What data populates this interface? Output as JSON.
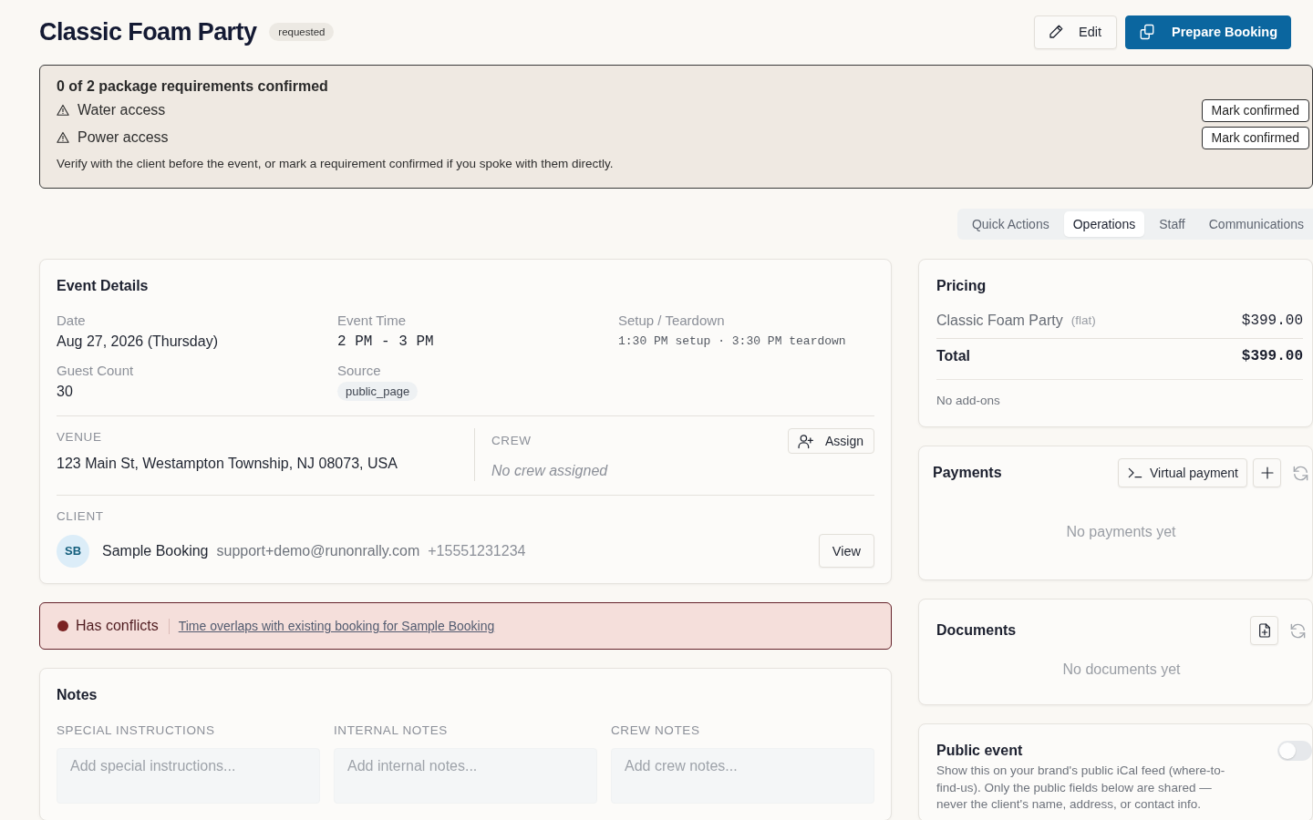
{
  "header": {
    "title": "Classic Foam Party",
    "status_badge": "requested",
    "buttons": [
      {
        "label": "Edit",
        "kind": "secondary"
      },
      {
        "label": "Prepare Booking",
        "kind": "primary"
      }
    ]
  },
  "requirements_alert": {
    "heading": "0 of 2 package requirements confirmed",
    "items": [
      {
        "label": "Water access",
        "confirmed": false,
        "action": "Mark confirmed"
      },
      {
        "label": "Power access",
        "confirmed": false,
        "action": "Mark confirmed"
      }
    ],
    "note": "Verify with the client before the event, or mark a requirement confirmed if you spoke with them directly."
  },
  "tabs": [
    {
      "label": "Quick Actions",
      "selected": false
    },
    {
      "label": "Operations",
      "selected": true
    },
    {
      "label": "Staff",
      "selected": false
    },
    {
      "label": "Communications",
      "selected": false
    }
  ],
  "event_details": {
    "title": "Event Details",
    "fields": [
      {
        "label": "Date",
        "value": "Aug 27, 2026 (Thursday)",
        "kind": "text"
      },
      {
        "label": "Event Time",
        "value": "2 PM - 3 PM",
        "kind": "mono"
      },
      {
        "label": "Setup / Teardown",
        "value": "1:30 PM setup · 3:30 PM teardown",
        "kind": "mono-small"
      },
      {
        "label": "Guest Count",
        "value": "30",
        "kind": "text"
      },
      {
        "label": "Source",
        "value": "public_page",
        "kind": "chip"
      }
    ],
    "venue": {
      "label": "VENUE",
      "value": "123 Main St, Westampton Township, NJ 08073, USA"
    },
    "crew": {
      "label": "CREW",
      "button": "Assign",
      "empty": "No crew assigned"
    },
    "client": {
      "label": "CLIENT",
      "initials": "SB",
      "name": "Sample Booking",
      "email": "support+demo@runonrally.com",
      "phone": "+15551231234",
      "button": "View"
    }
  },
  "conflict": {
    "status": "Has conflicts",
    "message": "Time overlaps with existing booking for Sample Booking"
  },
  "notes": {
    "title": "Notes",
    "fields": [
      {
        "label": "SPECIAL INSTRUCTIONS",
        "placeholder": "Add special instructions..."
      },
      {
        "label": "INTERNAL NOTES",
        "placeholder": "Add internal notes..."
      },
      {
        "label": "CREW NOTES",
        "placeholder": "Add crew notes..."
      }
    ]
  },
  "pricing": {
    "title": "Pricing",
    "line_items": [
      {
        "name": "Classic Foam Party",
        "unit": "(flat)",
        "amount": "$399.00"
      }
    ],
    "total": {
      "label": "Total",
      "amount": "$399.00"
    },
    "addons_note": "No add-ons"
  },
  "payments": {
    "title": "Payments",
    "button": "Virtual payment",
    "empty": "No payments yet"
  },
  "documents": {
    "title": "Documents",
    "empty": "No documents yet"
  },
  "public_event": {
    "title": "Public event",
    "description": "Show this on your brand's public iCal feed (where-to-find-us). Only the public fields below are shared — never the client's name, address, or contact info.",
    "toggle": {
      "on": false
    }
  }
}
